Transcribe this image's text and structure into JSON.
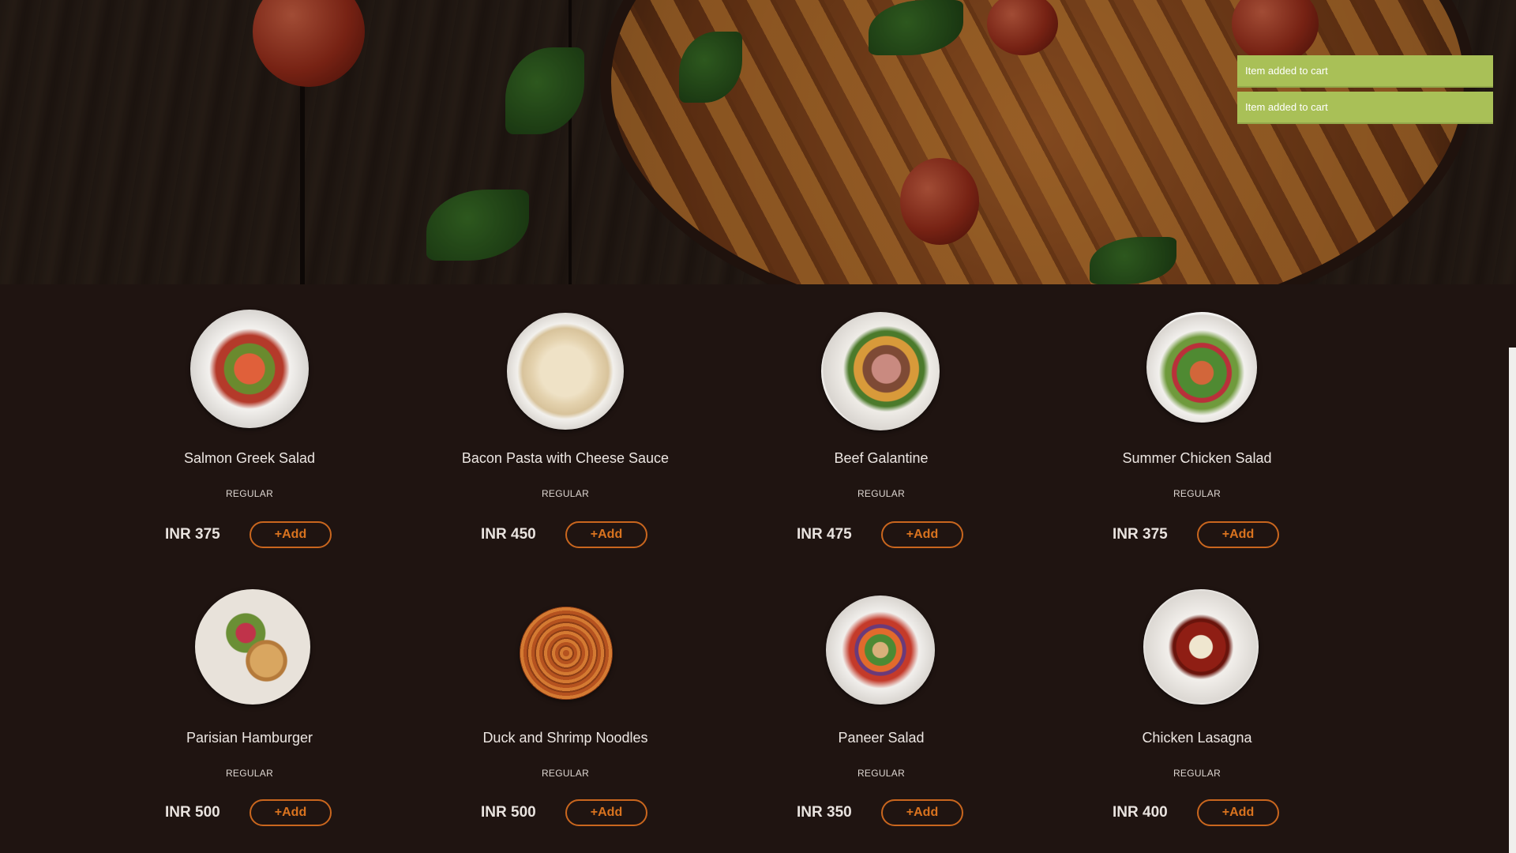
{
  "notifications": [
    {
      "text": "Item added to cart"
    },
    {
      "text": "Item added to cart"
    }
  ],
  "menu": {
    "items": [
      {
        "name": "Salmon Greek Salad",
        "variant": "REGULAR",
        "price": "INR 375",
        "add_label": "+Add",
        "image": "salmon-greek-salad-plate"
      },
      {
        "name": "Bacon Pasta with Cheese Sauce",
        "variant": "REGULAR",
        "price": "INR 450",
        "add_label": "+Add",
        "image": "bacon-pasta-plate"
      },
      {
        "name": "Beef Galantine",
        "variant": "REGULAR",
        "price": "INR 475",
        "add_label": "+Add",
        "image": "beef-galantine-plate"
      },
      {
        "name": "Summer Chicken Salad",
        "variant": "REGULAR",
        "price": "INR 375",
        "add_label": "+Add",
        "image": "summer-chicken-salad-plate"
      },
      {
        "name": "Parisian Hamburger",
        "variant": "REGULAR",
        "price": "INR 500",
        "add_label": "+Add",
        "image": "parisian-hamburger-plate"
      },
      {
        "name": "Duck and Shrimp Noodles",
        "variant": "REGULAR",
        "price": "INR 500",
        "add_label": "+Add",
        "image": "duck-shrimp-noodles-plate"
      },
      {
        "name": "Paneer Salad",
        "variant": "REGULAR",
        "price": "INR 350",
        "add_label": "+Add",
        "image": "paneer-salad-plate"
      },
      {
        "name": "Chicken Lasagna",
        "variant": "REGULAR",
        "price": "INR 400",
        "add_label": "+Add",
        "image": "chicken-lasagna-plate"
      }
    ]
  },
  "colors": {
    "background": "#1f1411",
    "toast": "#a9c057",
    "accent": "#d9731f"
  }
}
